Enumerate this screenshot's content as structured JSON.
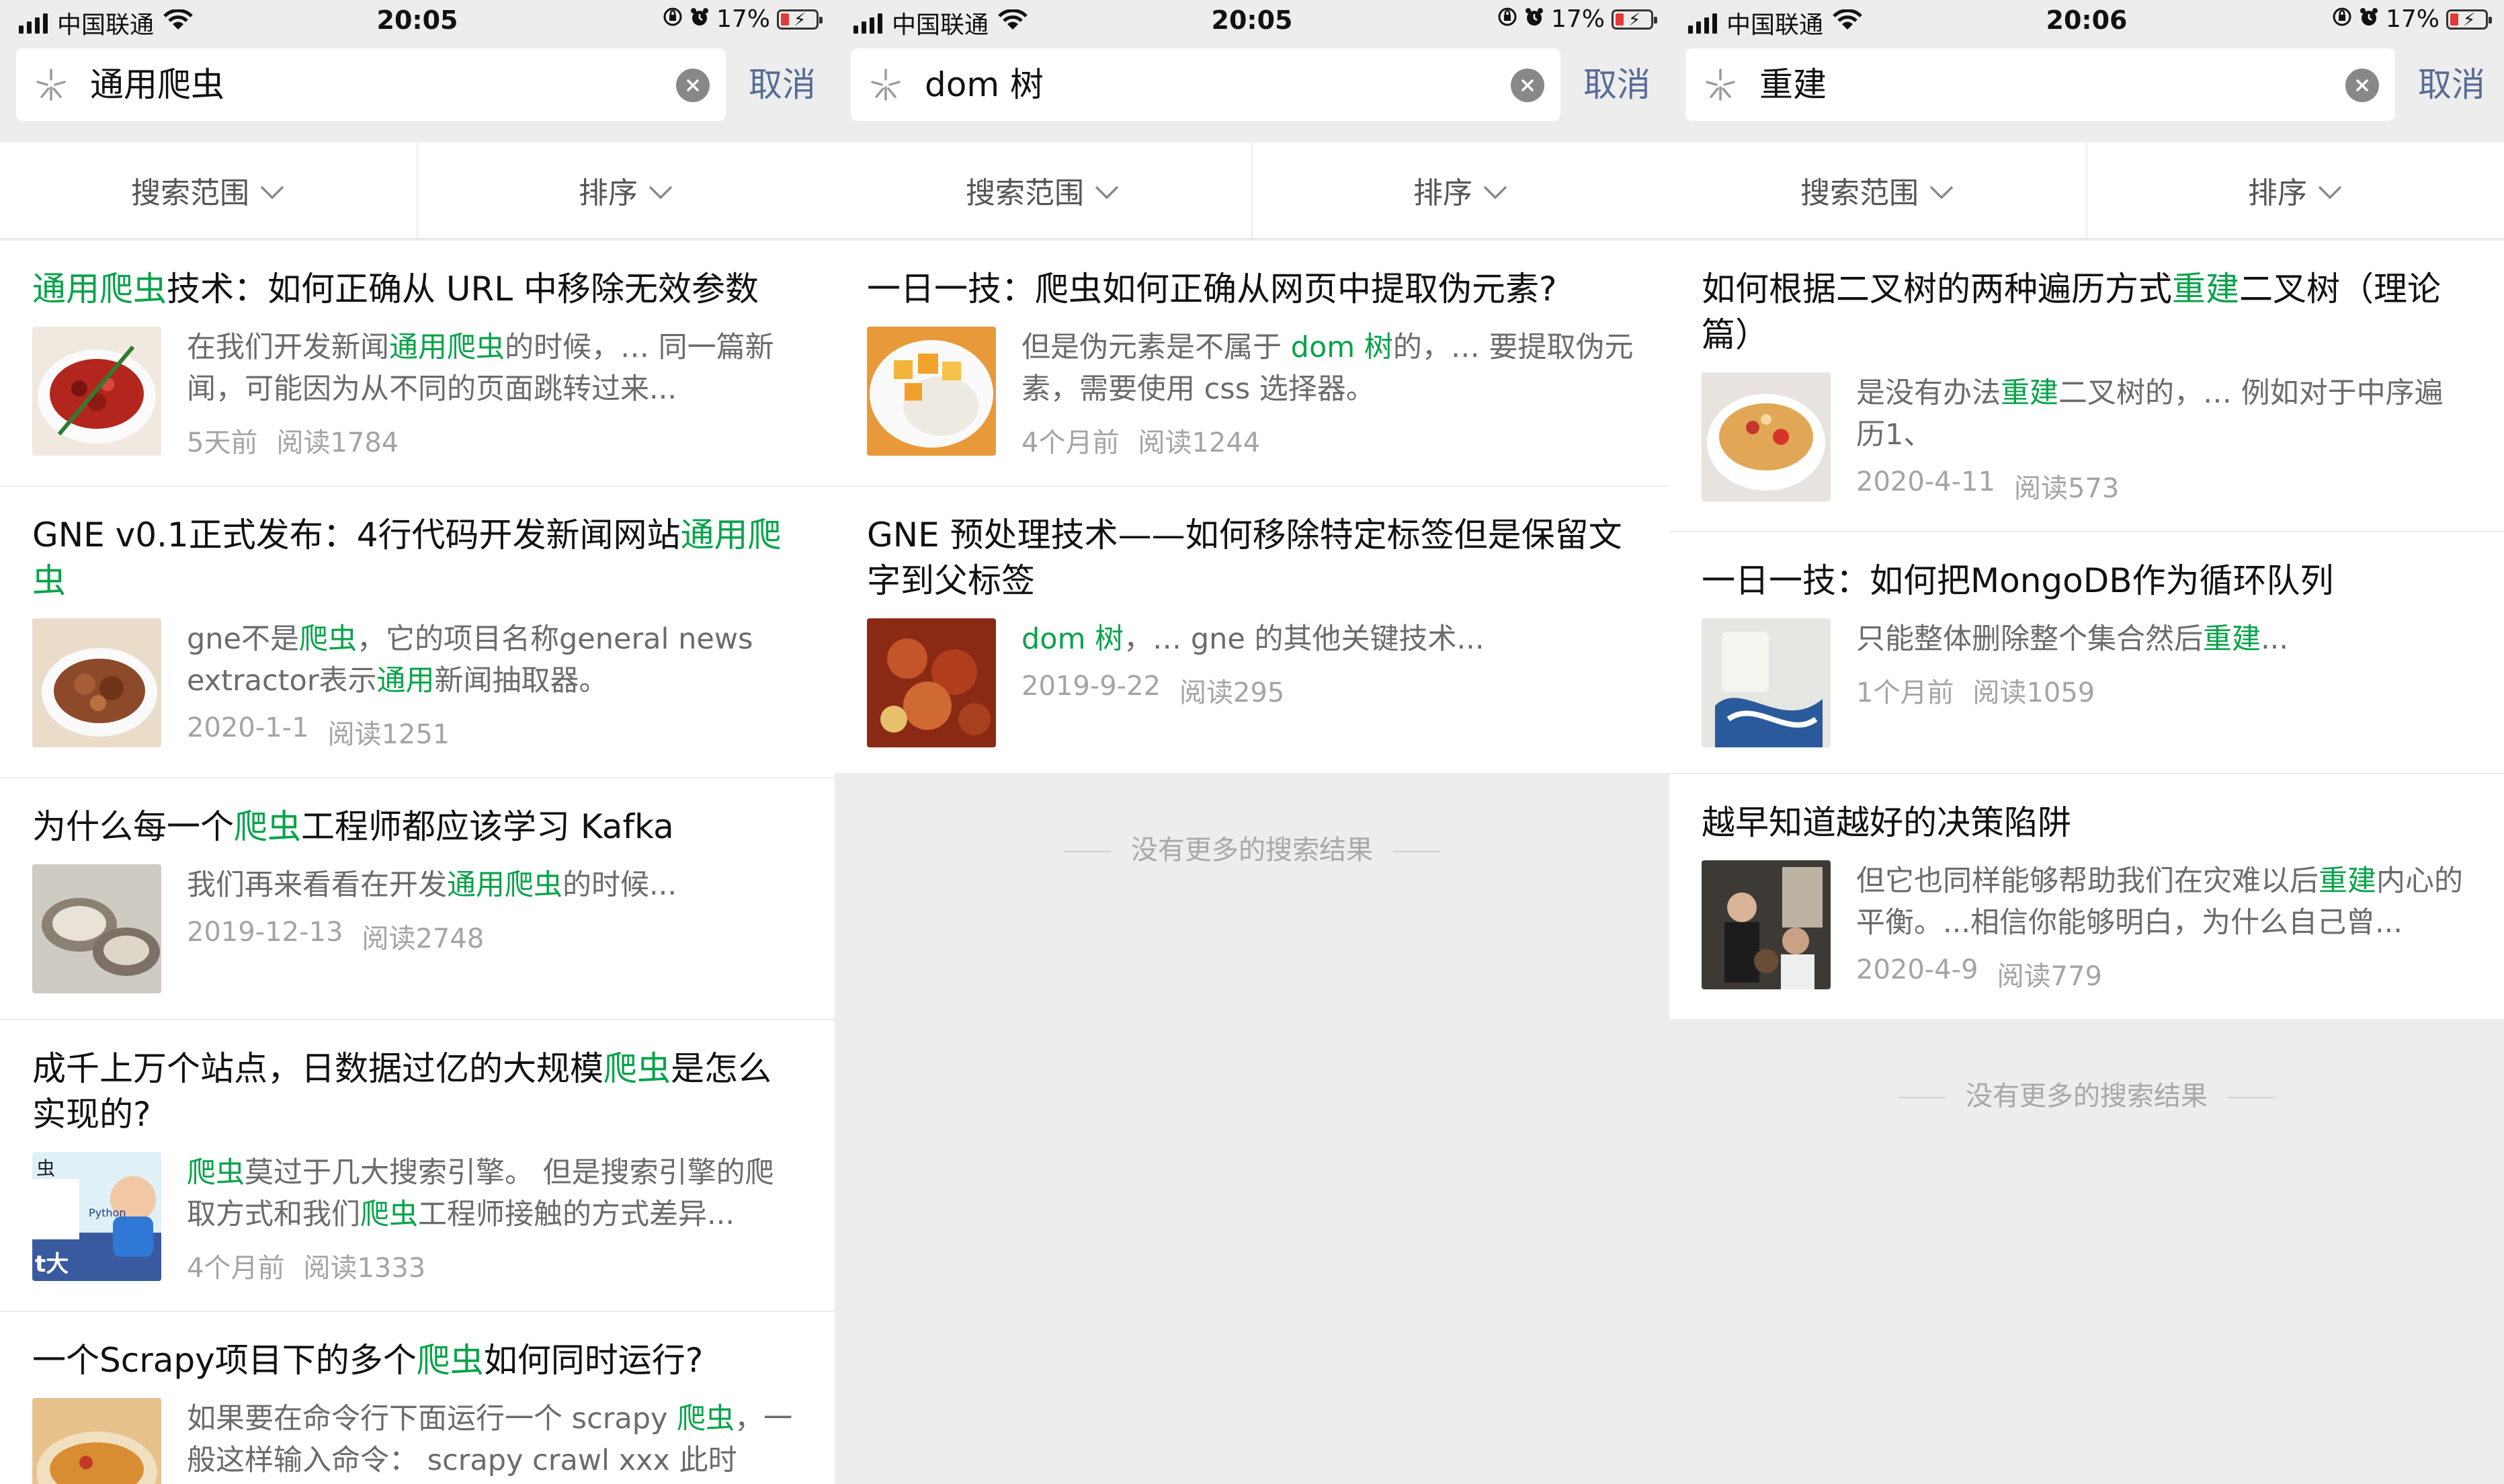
{
  "colors": {
    "highlight": "#07a34a",
    "cancel": "#576b95",
    "meta": "#a4a4a4"
  },
  "panels": [
    {
      "status": {
        "carrier": "中国联通",
        "time": "20:05",
        "battery": "17%"
      },
      "search": {
        "query": "通用爬虫",
        "cancel": "取消"
      },
      "filters": {
        "scope": "搜索范围",
        "sort": "排序"
      },
      "results": [
        {
          "title": [
            {
              "t": "通用爬虫",
              "h": true
            },
            {
              "t": "技术：如何正确从 URL 中移除无效参数"
            }
          ],
          "snippet": [
            {
              "t": "在我们开发新闻"
            },
            {
              "t": "通用爬虫",
              "h": true
            },
            {
              "t": "的时候，… 同一篇新闻，可能因为从不同的页面跳转过来..."
            }
          ],
          "date": "5天前",
          "reads": "阅读1784",
          "thumb": "chili"
        },
        {
          "title": [
            {
              "t": "GNE v0.1正式发布：4行代码开发新闻网站"
            },
            {
              "t": "通用爬虫",
              "h": true
            }
          ],
          "snippet": [
            {
              "t": "gne不是"
            },
            {
              "t": "爬虫",
              "h": true
            },
            {
              "t": "，它的项目名称general news extractor表示"
            },
            {
              "t": "通用",
              "h": true
            },
            {
              "t": "新闻抽取器。"
            }
          ],
          "date": "2020-1-1",
          "reads": "阅读1251",
          "thumb": "ribs"
        },
        {
          "title": [
            {
              "t": "为什么每一个"
            },
            {
              "t": "爬虫",
              "h": true
            },
            {
              "t": "工程师都应该学习 Kafka"
            }
          ],
          "snippet": [
            {
              "t": "我们再来看看在开发"
            },
            {
              "t": "通用爬虫",
              "h": true
            },
            {
              "t": "的时候..."
            }
          ],
          "date": "2019-12-13",
          "reads": "阅读2748",
          "thumb": "oyster"
        },
        {
          "title": [
            {
              "t": "成千上万个站点，日数据过亿的大规模"
            },
            {
              "t": "爬虫",
              "h": true
            },
            {
              "t": "是怎么实现的?"
            }
          ],
          "snippet": [
            {
              "t": "爬虫",
              "h": true
            },
            {
              "t": "莫过于几大搜索引擎。 但是搜索引擎的爬取方式和我们"
            },
            {
              "t": "爬虫",
              "h": true
            },
            {
              "t": "工程师接触的方式差异..."
            }
          ],
          "date": "4个月前",
          "reads": "阅读1333",
          "thumb": "python",
          "thumbText": {
            "a": "虫",
            "b": "Python",
            "c": "t大"
          }
        },
        {
          "title": [
            {
              "t": "一个Scrapy项目下的多个"
            },
            {
              "t": "爬虫",
              "h": true
            },
            {
              "t": "如何同时运行?"
            }
          ],
          "snippet": [
            {
              "t": "如果要在命令行下面运行一个 scrapy "
            },
            {
              "t": "爬虫",
              "h": true
            },
            {
              "t": "，一般这样输入命令： scrapy crawl xxx 此时"
            }
          ],
          "date": "",
          "reads": "",
          "thumb": "noodle"
        }
      ],
      "noMore": null
    },
    {
      "status": {
        "carrier": "中国联通",
        "time": "20:05",
        "battery": "17%"
      },
      "search": {
        "query": "dom 树",
        "cancel": "取消"
      },
      "filters": {
        "scope": "搜索范围",
        "sort": "排序"
      },
      "results": [
        {
          "title": [
            {
              "t": "一日一技：爬虫如何正确从网页中提取伪元素?"
            }
          ],
          "snippet": [
            {
              "t": "但是伪元素是不属于 "
            },
            {
              "t": "dom 树",
              "h": true
            },
            {
              "t": "的，… 要提取伪元素，需要使用 css 选择器。"
            }
          ],
          "date": "4个月前",
          "reads": "阅读1244",
          "thumb": "rice"
        },
        {
          "title": [
            {
              "t": "GNE 预处理技术——如何移除特定标签但是保留文字到父标签"
            }
          ],
          "snippet": [
            {
              "t": "dom 树",
              "h": true
            },
            {
              "t": "，… gne 的其他关键技术..."
            }
          ],
          "date": "2019-9-22",
          "reads": "阅读295",
          "thumb": "chicken"
        }
      ],
      "noMore": "没有更多的搜索结果"
    },
    {
      "status": {
        "carrier": "中国联通",
        "time": "20:06",
        "battery": "17%"
      },
      "search": {
        "query": "重建",
        "cancel": "取消"
      },
      "filters": {
        "scope": "搜索范围",
        "sort": "排序"
      },
      "results": [
        {
          "title": [
            {
              "t": "如何根据二叉树的两种遍历方式"
            },
            {
              "t": "重建",
              "h": true
            },
            {
              "t": "二叉树（理论篇）"
            }
          ],
          "snippet": [
            {
              "t": "是没有办法"
            },
            {
              "t": "重建",
              "h": true
            },
            {
              "t": "二叉树的，… 例如对于中序遍历1、"
            }
          ],
          "date": "2020-4-11",
          "reads": "阅读573",
          "thumb": "granola"
        },
        {
          "title": [
            {
              "t": "一日一技：如何把MongoDB作为循环队列"
            }
          ],
          "snippet": [
            {
              "t": "只能整体删除整个集合然后"
            },
            {
              "t": "重建",
              "h": true
            },
            {
              "t": "..."
            }
          ],
          "date": "1个月前",
          "reads": "阅读1059",
          "thumb": "cloth"
        },
        {
          "title": [
            {
              "t": "越早知道越好的决策陷阱"
            }
          ],
          "snippet": [
            {
              "t": "但它也同样能够帮助我们在灾难以后"
            },
            {
              "t": "重建",
              "h": true
            },
            {
              "t": "内心的平衡。...相信你能够明白，为什么自己曾..."
            }
          ],
          "date": "2020-4-9",
          "reads": "阅读779",
          "thumb": "people"
        }
      ],
      "noMore": "没有更多的搜索结果"
    }
  ]
}
